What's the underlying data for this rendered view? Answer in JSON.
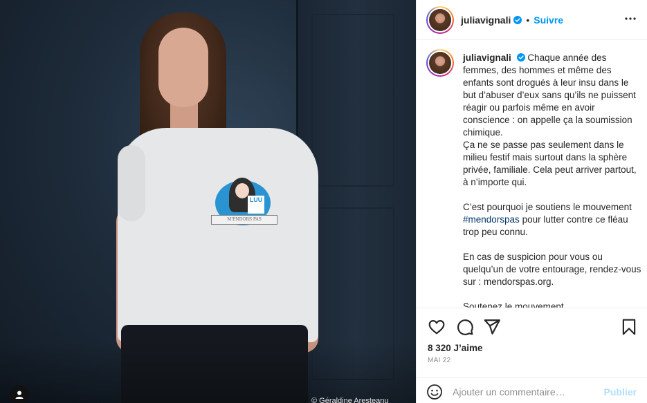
{
  "post": {
    "username": "juliavignali",
    "follow_label": "Suivre",
    "separator": "•",
    "more_icon": "more-horizontal-icon",
    "photo_credit": "© Géraldine Aresteanu",
    "shirt_print": {
      "badge": "LUU",
      "ribbon": "M'ENDORS PAS"
    }
  },
  "caption": {
    "username": "juliavignali",
    "lines": [
      "Chaque année des femmes, des hommes et même des enfants sont drogués à leur insu dans le but d’abuser d’eux sans qu’ils ne puissent réagir ou parfois même en avoir conscience : on appelle ça la soumission chimique.",
      "Ça ne se passe pas seulement dans le milieu festif mais surtout dans la sphère privée, familiale. Cela peut arriver partout, à n’importe qui."
    ],
    "para2_before": "C’est pourquoi je soutiens le mouvement ",
    "para2_hashtag": "#mendorspas",
    "para2_after": " pour lutter contre ce fléau trop peu connu.",
    "para3": "En cas de suspicion pour vous ou quelqu’un de votre entourage, rendez-vous sur : mendorspas.org.",
    "para4": "Soutenez le mouvement"
  },
  "actions": {
    "likes": "8 320 J’aime",
    "date": "MAI 22"
  },
  "comment": {
    "placeholder": "Ajouter un commentaire…",
    "publish_label": "Publier"
  },
  "colors": {
    "accent": "#0095f6",
    "publish_disabled": "#b2dffc",
    "hashtag": "#00376b",
    "muted": "#8e8e8e"
  }
}
